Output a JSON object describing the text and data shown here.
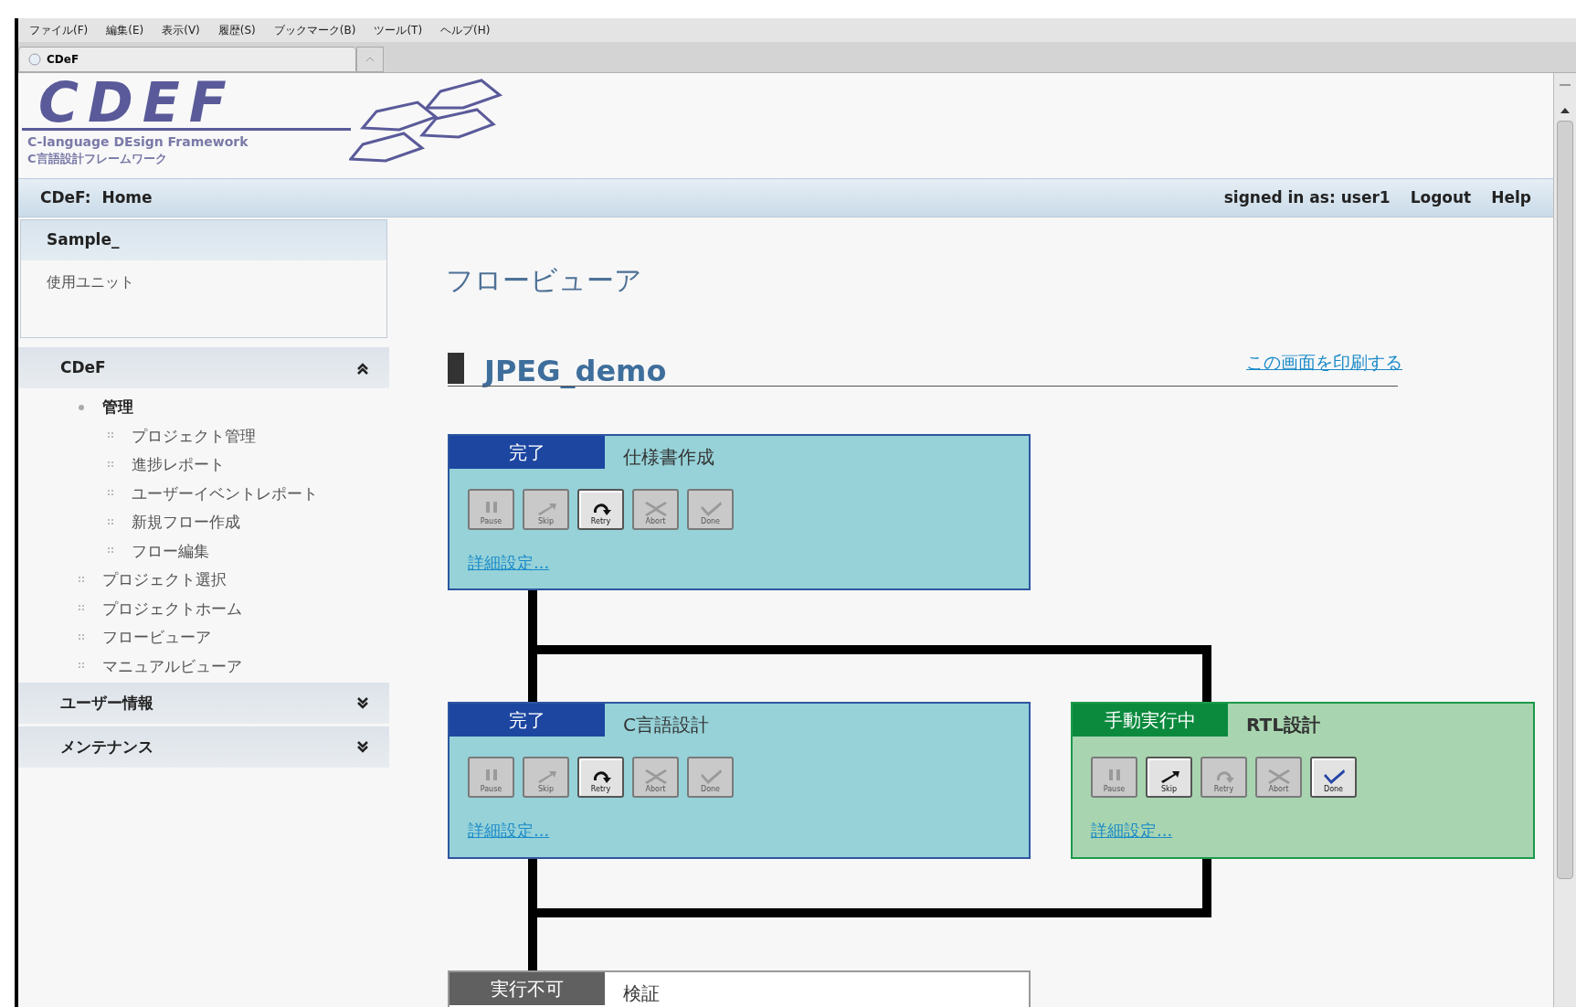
{
  "menu_bar": [
    "ファイル(F)",
    "編集(E)",
    "表示(V)",
    "履歴(S)",
    "ブックマーク(B)",
    "ツール(T)",
    "ヘルプ(H)"
  ],
  "browser_tab": {
    "title": "CDeF"
  },
  "logo": {
    "title": "CDEF",
    "subtitle": "C-language DEsign Framework",
    "subtitle_ja": "C言語設計フレームワーク"
  },
  "header": {
    "breadcrumb": "CDeF:  Home",
    "signed_in": "signed in as: user1",
    "links": [
      "Logout",
      "Help"
    ]
  },
  "sidebar": {
    "project_panel": {
      "title": "Sample_",
      "items": [
        "使用ユニット"
      ]
    },
    "sections": [
      {
        "title": "CDeF",
        "expanded": true,
        "items": [
          {
            "label": "管理",
            "children": [
              {
                "label": "プロジェクト管理"
              },
              {
                "label": "進捗レポート"
              },
              {
                "label": "ユーザーイベントレポート"
              },
              {
                "label": "新規フロー作成"
              },
              {
                "label": "フロー編集"
              }
            ]
          },
          {
            "label": "プロジェクト選択"
          },
          {
            "label": "プロジェクトホーム"
          },
          {
            "label": "フロービューア"
          },
          {
            "label": "マニュアルビューア"
          }
        ]
      },
      {
        "title": "ユーザー情報",
        "expanded": false
      },
      {
        "title": "メンテナンス",
        "expanded": false
      }
    ]
  },
  "page": {
    "title": "フロービューア",
    "flow_name": "JPEG_demo",
    "print_link": "この画面を印刷する"
  },
  "flow_nodes": [
    {
      "status": "完了",
      "kind": "done",
      "title": "仕様書作成",
      "link": "詳細設定...",
      "buttons": [
        {
          "kind": "pause",
          "label": "Pause",
          "disabled": true
        },
        {
          "kind": "skip",
          "label": "Skip",
          "disabled": true
        },
        {
          "kind": "retry",
          "label": "Retry",
          "disabled": false
        },
        {
          "kind": "abort",
          "label": "Abort",
          "disabled": true
        },
        {
          "kind": "done",
          "label": "Done",
          "disabled": true
        }
      ]
    },
    {
      "status": "完了",
      "kind": "done",
      "title": "C言語設計",
      "link": "詳細設定...",
      "buttons": [
        {
          "kind": "pause",
          "label": "Pause",
          "disabled": true
        },
        {
          "kind": "skip",
          "label": "Skip",
          "disabled": true
        },
        {
          "kind": "retry",
          "label": "Retry",
          "disabled": false
        },
        {
          "kind": "abort",
          "label": "Abort",
          "disabled": true
        },
        {
          "kind": "done",
          "label": "Done",
          "disabled": true
        }
      ]
    },
    {
      "status": "手動実行中",
      "kind": "manual",
      "title": "RTL設計",
      "link": "詳細設定...",
      "buttons": [
        {
          "kind": "pause",
          "label": "Pause",
          "disabled": true
        },
        {
          "kind": "skip",
          "label": "Skip",
          "disabled": false
        },
        {
          "kind": "retry",
          "label": "Retry",
          "disabled": true
        },
        {
          "kind": "abort",
          "label": "Abort",
          "disabled": true
        },
        {
          "kind": "done",
          "label": "Done",
          "disabled": false
        }
      ]
    },
    {
      "status": "実行不可",
      "kind": "blocked",
      "title": "検証"
    }
  ]
}
